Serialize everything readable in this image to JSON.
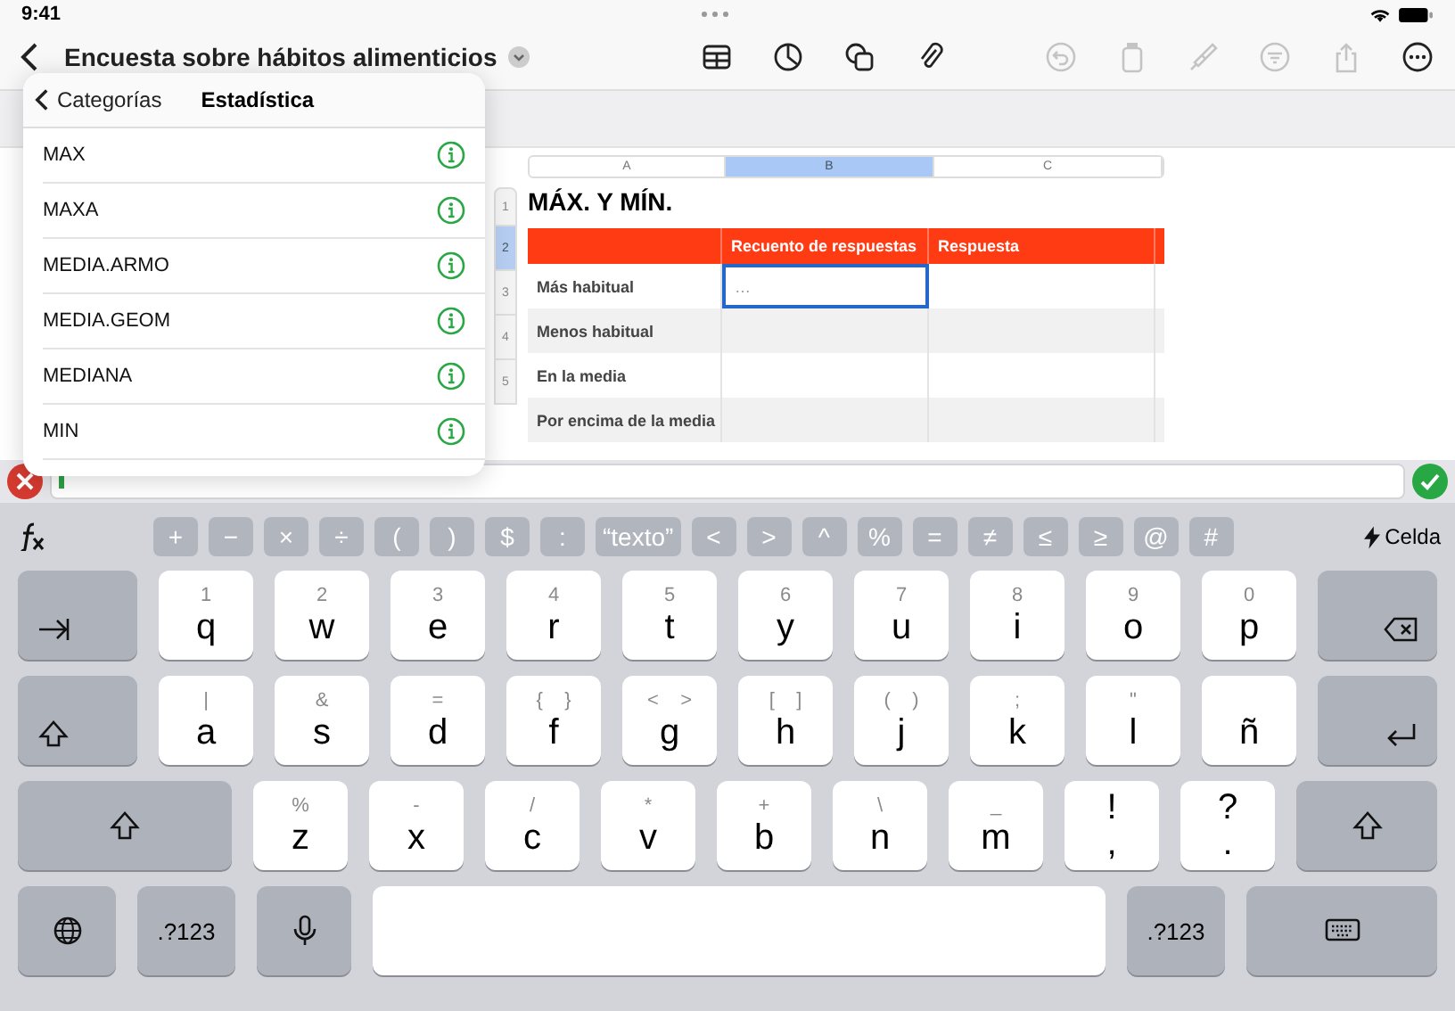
{
  "status_bar": {
    "time": "9:41"
  },
  "toolbar": {
    "title": "Encuesta sobre hábitos alimenticios",
    "tools": [
      {
        "kind": "table",
        "disabled": false
      },
      {
        "kind": "chart",
        "disabled": false
      },
      {
        "kind": "shapes",
        "disabled": false
      },
      {
        "kind": "attachment",
        "disabled": false
      },
      {
        "kind": "undo",
        "disabled": true
      },
      {
        "kind": "paste",
        "disabled": true
      },
      {
        "kind": "brush",
        "disabled": true
      },
      {
        "kind": "filter",
        "disabled": true
      },
      {
        "kind": "share",
        "disabled": true
      },
      {
        "kind": "more",
        "disabled": false
      }
    ]
  },
  "function_browser": {
    "back": "Categorías",
    "title": "Estadística",
    "functions": [
      {
        "name": "MAX"
      },
      {
        "name": "MAXA"
      },
      {
        "name": "MEDIA.ARMO"
      },
      {
        "name": "MEDIA.GEOM"
      },
      {
        "name": "MEDIANA"
      },
      {
        "name": "MIN"
      }
    ]
  },
  "sheet": {
    "columns": [
      {
        "label": "A",
        "selected": false
      },
      {
        "label": "B",
        "selected": true
      },
      {
        "label": "C",
        "selected": false
      }
    ],
    "row_numbers": [
      {
        "label": "1",
        "selected": false
      },
      {
        "label": "2",
        "selected": true
      },
      {
        "label": "3",
        "selected": false
      },
      {
        "label": "4",
        "selected": false
      },
      {
        "label": "5",
        "selected": false
      }
    ],
    "table": {
      "title": "MÁX. Y MÍN.",
      "headers": [
        "Recuento de respuestas",
        "Respuesta"
      ],
      "rows": [
        {
          "label": "Más habitual",
          "count": "…",
          "selected": true
        },
        {
          "label": "Menos habitual",
          "selected": false
        },
        {
          "label": "En la media",
          "selected": false
        },
        {
          "label": "Por encima de la media",
          "selected": false
        }
      ]
    }
  },
  "keyboard": {
    "function_keys": [
      "+",
      "−",
      "×",
      "÷",
      "(",
      ")",
      "$",
      ":",
      "“texto”",
      "<",
      ">",
      "^",
      "%",
      "=",
      "≠",
      "≤",
      "≥",
      "@",
      "#"
    ],
    "cell_button": "Celda",
    "rows": [
      [
        {
          "kind": "tab"
        },
        {
          "kind": "char",
          "main": "q",
          "hint": "1"
        },
        {
          "kind": "char",
          "main": "w",
          "hint": "2"
        },
        {
          "kind": "char",
          "main": "e",
          "hint": "3"
        },
        {
          "kind": "char",
          "main": "r",
          "hint": "4"
        },
        {
          "kind": "char",
          "main": "t",
          "hint": "5"
        },
        {
          "kind": "char",
          "main": "y",
          "hint": "6"
        },
        {
          "kind": "char",
          "main": "u",
          "hint": "7"
        },
        {
          "kind": "char",
          "main": "i",
          "hint": "8"
        },
        {
          "kind": "char",
          "main": "o",
          "hint": "9"
        },
        {
          "kind": "char",
          "main": "p",
          "hint": "0"
        },
        {
          "kind": "delete"
        }
      ],
      [
        {
          "kind": "caps"
        },
        {
          "kind": "char",
          "main": "a",
          "hint": "|"
        },
        {
          "kind": "char",
          "main": "s",
          "hint": "&"
        },
        {
          "kind": "char",
          "main": "d",
          "hint": "="
        },
        {
          "kind": "char",
          "main": "f",
          "hint": "{    }"
        },
        {
          "kind": "char",
          "main": "g",
          "hint": "<    >"
        },
        {
          "kind": "char",
          "main": "h",
          "hint": "[    ]"
        },
        {
          "kind": "char",
          "main": "j",
          "hint": "(    )"
        },
        {
          "kind": "char",
          "main": "k",
          "hint": ";"
        },
        {
          "kind": "char",
          "main": "l",
          "hint": "\""
        },
        {
          "kind": "char",
          "main": "ñ"
        },
        {
          "kind": "return"
        }
      ],
      [
        {
          "kind": "shift"
        },
        {
          "kind": "char",
          "main": "z",
          "hint": "%"
        },
        {
          "kind": "char",
          "main": "x",
          "hint": "-"
        },
        {
          "kind": "char",
          "main": "c",
          "hint": "/"
        },
        {
          "kind": "char",
          "main": "v",
          "hint": "*"
        },
        {
          "kind": "char",
          "main": "b",
          "hint": "+"
        },
        {
          "kind": "char",
          "main": "n",
          "hint": "\\"
        },
        {
          "kind": "char",
          "main": "m",
          "hint": "_"
        },
        {
          "kind": "punct",
          "main": ",",
          "hint": "!"
        },
        {
          "kind": "punct",
          "main": ".",
          "hint": "?"
        },
        {
          "kind": "shift"
        }
      ],
      [
        {
          "kind": "globe"
        },
        {
          "kind": "mode",
          "main": ".?123"
        },
        {
          "kind": "mic"
        },
        {
          "kind": "space"
        },
        {
          "kind": "mode",
          "main": ".?123"
        },
        {
          "kind": "hide"
        }
      ]
    ]
  }
}
